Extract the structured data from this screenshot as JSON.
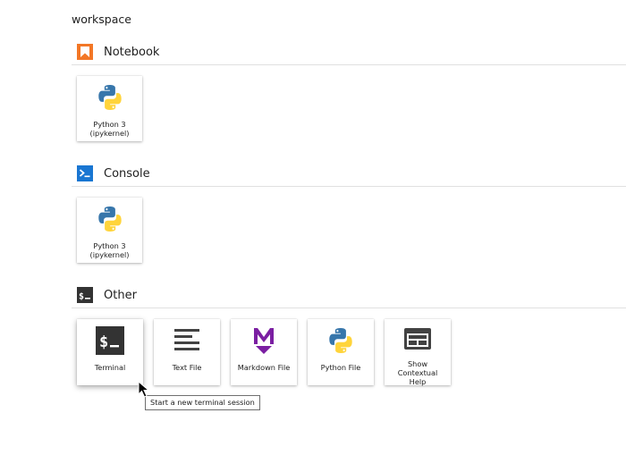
{
  "breadcrumb": "workspace",
  "sections": {
    "notebook": {
      "title": "Notebook",
      "icon": "notebook-icon",
      "accent": "#f37726",
      "cards": [
        {
          "label": "Python 3\n(ipykernel)",
          "icon": "python-logo-icon"
        }
      ]
    },
    "console": {
      "title": "Console",
      "icon": "console-icon",
      "accent": "#1976d2",
      "cards": [
        {
          "label": "Python 3\n(ipykernel)",
          "icon": "python-logo-icon"
        }
      ]
    },
    "other": {
      "title": "Other",
      "icon": "terminal-icon",
      "accent": "#333333",
      "cards": [
        {
          "label": "Terminal",
          "icon": "terminal-icon"
        },
        {
          "label": "Text File",
          "icon": "text-file-icon"
        },
        {
          "label": "Markdown File",
          "icon": "markdown-icon"
        },
        {
          "label": "Python File",
          "icon": "python-logo-icon"
        },
        {
          "label": "Show Contextual\nHelp",
          "icon": "contextual-help-icon"
        }
      ]
    }
  },
  "tooltip": "Start a new terminal session",
  "colors": {
    "markdown": "#7b1fa2",
    "python_blue": "#3776ab",
    "python_yellow": "#ffd43b",
    "icon_gray": "#424242"
  }
}
